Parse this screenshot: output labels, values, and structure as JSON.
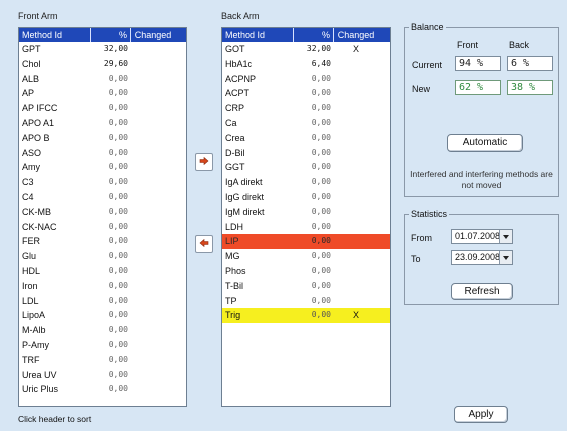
{
  "front_arm": {
    "title": "Front Arm",
    "columns": {
      "name": "Method Id",
      "pct": "%",
      "changed": "Changed"
    },
    "rows": [
      {
        "name": "GPT",
        "pct": "32,00",
        "changed": ""
      },
      {
        "name": "Chol",
        "pct": "29,60",
        "changed": ""
      },
      {
        "name": "ALB",
        "pct": "0,00",
        "changed": ""
      },
      {
        "name": "AP",
        "pct": "0,00",
        "changed": ""
      },
      {
        "name": "AP IFCC",
        "pct": "0,00",
        "changed": ""
      },
      {
        "name": "APO A1",
        "pct": "0,00",
        "changed": ""
      },
      {
        "name": "APO B",
        "pct": "0,00",
        "changed": ""
      },
      {
        "name": "ASO",
        "pct": "0,00",
        "changed": ""
      },
      {
        "name": "Amy",
        "pct": "0,00",
        "changed": ""
      },
      {
        "name": "C3",
        "pct": "0,00",
        "changed": ""
      },
      {
        "name": "C4",
        "pct": "0,00",
        "changed": ""
      },
      {
        "name": "CK-MB",
        "pct": "0,00",
        "changed": ""
      },
      {
        "name": "CK-NAC",
        "pct": "0,00",
        "changed": ""
      },
      {
        "name": "FER",
        "pct": "0,00",
        "changed": ""
      },
      {
        "name": "Glu",
        "pct": "0,00",
        "changed": ""
      },
      {
        "name": "HDL",
        "pct": "0,00",
        "changed": ""
      },
      {
        "name": "Iron",
        "pct": "0,00",
        "changed": ""
      },
      {
        "name": "LDL",
        "pct": "0,00",
        "changed": ""
      },
      {
        "name": "LipoA",
        "pct": "0,00",
        "changed": ""
      },
      {
        "name": "M-Alb",
        "pct": "0,00",
        "changed": ""
      },
      {
        "name": "P-Amy",
        "pct": "0,00",
        "changed": ""
      },
      {
        "name": "TRF",
        "pct": "0,00",
        "changed": ""
      },
      {
        "name": "Urea UV",
        "pct": "0,00",
        "changed": ""
      },
      {
        "name": "Uric Plus",
        "pct": "0,00",
        "changed": ""
      }
    ]
  },
  "back_arm": {
    "title": "Back Arm",
    "columns": {
      "name": "Method Id",
      "pct": "%",
      "changed": "Changed"
    },
    "rows": [
      {
        "name": "GOT",
        "pct": "32,00",
        "changed": "X",
        "highlight": ""
      },
      {
        "name": "HbA1c",
        "pct": "6,40",
        "changed": "",
        "highlight": ""
      },
      {
        "name": "ACPNP",
        "pct": "0,00",
        "changed": "",
        "highlight": ""
      },
      {
        "name": "ACPT",
        "pct": "0,00",
        "changed": "",
        "highlight": ""
      },
      {
        "name": "CRP",
        "pct": "0,00",
        "changed": "",
        "highlight": ""
      },
      {
        "name": "Ca",
        "pct": "0,00",
        "changed": "",
        "highlight": ""
      },
      {
        "name": "Crea",
        "pct": "0,00",
        "changed": "",
        "highlight": ""
      },
      {
        "name": "D-Bil",
        "pct": "0,00",
        "changed": "",
        "highlight": ""
      },
      {
        "name": "GGT",
        "pct": "0,00",
        "changed": "",
        "highlight": ""
      },
      {
        "name": "IgA direkt",
        "pct": "0,00",
        "changed": "",
        "highlight": ""
      },
      {
        "name": "IgG direkt",
        "pct": "0,00",
        "changed": "",
        "highlight": ""
      },
      {
        "name": "IgM direkt",
        "pct": "0,00",
        "changed": "",
        "highlight": ""
      },
      {
        "name": "LDH",
        "pct": "0,00",
        "changed": "",
        "highlight": ""
      },
      {
        "name": "LIP",
        "pct": "0,00",
        "changed": "",
        "highlight": "red"
      },
      {
        "name": "MG",
        "pct": "0,00",
        "changed": "",
        "highlight": ""
      },
      {
        "name": "Phos",
        "pct": "0,00",
        "changed": "",
        "highlight": ""
      },
      {
        "name": "T-Bil",
        "pct": "0,00",
        "changed": "",
        "highlight": ""
      },
      {
        "name": "TP",
        "pct": "0,00",
        "changed": "",
        "highlight": ""
      },
      {
        "name": "Trig",
        "pct": "0,00",
        "changed": "X",
        "highlight": "yellow"
      }
    ]
  },
  "balance": {
    "legend": "Balance",
    "front_label": "Front",
    "back_label": "Back",
    "current_label": "Current",
    "new_label": "New",
    "current_front": "94 %",
    "current_back": "6 %",
    "new_front": "62 %",
    "new_back": "38 %",
    "automatic_label": "Automatic",
    "note": "Interfered and interfering methods are not moved"
  },
  "statistics": {
    "legend": "Statistics",
    "from_label": "From",
    "to_label": "To",
    "from_value": "01.07.2008",
    "to_value": "23.09.2008",
    "refresh_label": "Refresh"
  },
  "footer": {
    "hint": "Click header to sort",
    "apply_label": "Apply"
  },
  "icons": {
    "move_right": "arrow-right-icon",
    "move_left": "arrow-left-icon",
    "dropdown": "chevron-down-icon"
  },
  "colors": {
    "header_bg": "#1f48b8",
    "highlight_red": "#ef4b28",
    "highlight_yellow": "#f6ef1f",
    "new_value_green": "#2f8a3e",
    "background": "#d7e6f4"
  }
}
